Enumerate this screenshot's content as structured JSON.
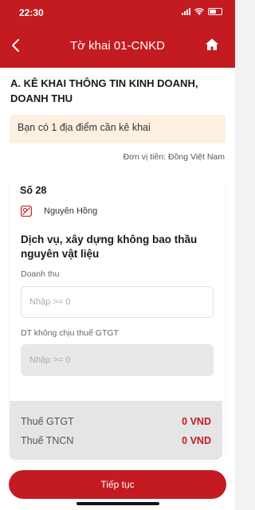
{
  "status": {
    "time": "22:30"
  },
  "header": {
    "title": "Tờ khai 01-CNKD"
  },
  "section": {
    "title": "A. KÊ KHAI THÔNG TIN KINH DOANH, DOANH THU"
  },
  "notice": {
    "text": "Bạn có 1 địa điểm cần kê khai"
  },
  "currency": {
    "text": "Đơn vị tiền: Đồng Việt Nam"
  },
  "card": {
    "number": "Số 28",
    "owner": "Nguyên Hồng",
    "activity": "Dịch vụ, xây dựng không bao thầu nguyên vật liệu",
    "revenue": {
      "label": "Doanh thu",
      "placeholder": "Nhập >= 0",
      "value": ""
    },
    "non_vat_revenue": {
      "label": "DT không chịu thuế GTGT",
      "placeholder": "Nhập >= 0",
      "value": ""
    }
  },
  "taxes": [
    {
      "label": "Thuế GTGT",
      "value": "0 VND"
    },
    {
      "label": "Thuế TNCN",
      "value": "0 VND"
    }
  ],
  "actions": {
    "continue_label": "Tiếp tục"
  },
  "colors": {
    "brand": "#c41a21",
    "notice_bg": "#fdf0e0"
  }
}
